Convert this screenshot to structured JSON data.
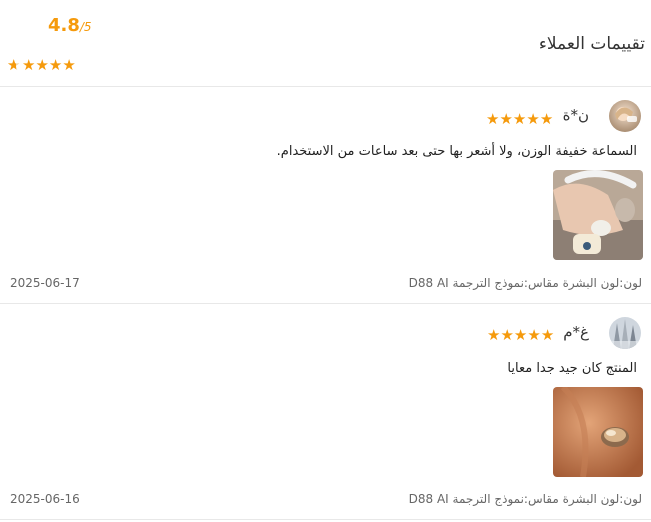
{
  "header": {
    "title": "تقييمات العملاء",
    "rating": "4.8",
    "rating_max": "/5",
    "stars": 4.8
  },
  "reviews": [
    {
      "user": "ن*ة",
      "stars": 5,
      "text": "السماعة خفيفة الوزن، ولا أشعر بها حتى بعد ساعات من الاستخدام.",
      "meta": "لون:لون البشرة مقاس:نموذج الترجمة D88 AI",
      "date": "2025-06-17"
    },
    {
      "user": "غ*م",
      "stars": 5,
      "text": "المنتج كان جيد جدا معايا",
      "meta": "لون:لون البشرة مقاس:نموذج الترجمة D88 AI",
      "date": "2025-06-16"
    }
  ]
}
